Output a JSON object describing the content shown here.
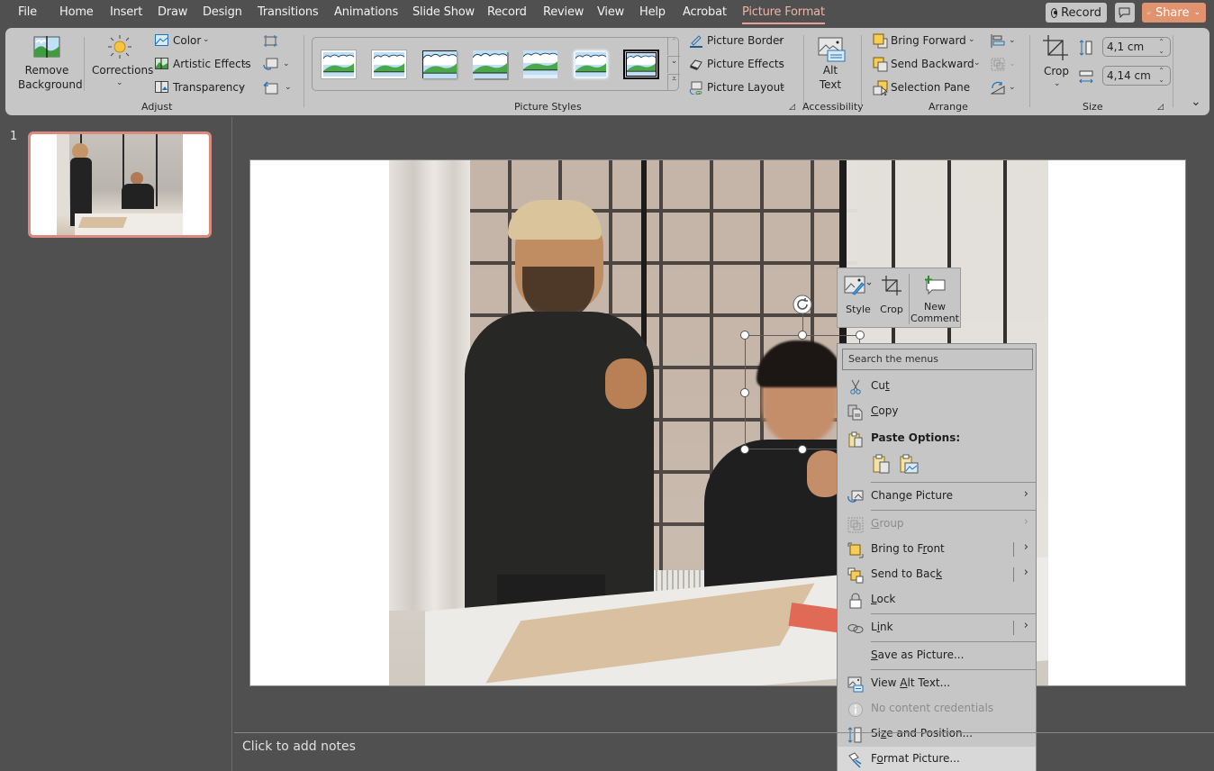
{
  "menubar": {
    "tabs": [
      "File",
      "Home",
      "Insert",
      "Draw",
      "Design",
      "Transitions",
      "Animations",
      "Slide Show",
      "Record",
      "Review",
      "View",
      "Help",
      "Acrobat",
      "Picture Format"
    ],
    "active_tab": "Picture Format",
    "record_label": "Record",
    "share_label": "Share",
    "accent_color": "#e1926e"
  },
  "ribbon": {
    "adjust": {
      "remove_background": [
        "Remove",
        "Background"
      ],
      "corrections": "Corrections",
      "color": "Color",
      "artistic_effects": "Artistic Effects",
      "transparency": "Transparency",
      "group_label": "Adjust"
    },
    "picture_styles": {
      "group_label": "Picture Styles",
      "style_count": 7,
      "picture_border": "Picture Border",
      "picture_effects": "Picture Effects",
      "picture_layout": "Picture Layout"
    },
    "accessibility": {
      "alt_text": [
        "Alt",
        "Text"
      ],
      "group_label": "Accessibility"
    },
    "arrange": {
      "bring_forward": "Bring Forward",
      "send_backward": "Send Backward",
      "selection_pane": "Selection Pane",
      "group_label": "Arrange"
    },
    "size": {
      "crop": "Crop",
      "height": "4,1 cm",
      "width": "4,14 cm",
      "group_label": "Size"
    }
  },
  "slides_panel": {
    "slide_number": "1"
  },
  "notes": {
    "placeholder": "Click to add notes"
  },
  "mini_toolbar": {
    "style": "Style",
    "crop": "Crop",
    "new_comment": [
      "New",
      "Comment"
    ]
  },
  "context_menu": {
    "search_placeholder": "Search the menus",
    "items": [
      {
        "label": "Cut",
        "icon": "scissors-icon"
      },
      {
        "label": "Copy",
        "icon": "copy-icon"
      },
      {
        "label": "Paste Options:",
        "icon": "paste-icon"
      },
      {
        "label": "Change Picture",
        "icon": "change-picture-icon",
        "submenu": true
      },
      {
        "label": "Group",
        "icon": "group-icon",
        "submenu": true,
        "disabled": true
      },
      {
        "label": "Bring to Front",
        "icon": "bring-to-front-icon",
        "submenu": true
      },
      {
        "label": "Send to Back",
        "icon": "send-to-back-icon",
        "submenu": true
      },
      {
        "label": "Lock",
        "icon": "lock-icon"
      },
      {
        "label": "Link",
        "icon": "link-icon",
        "submenu": true
      },
      {
        "label": "Save as Picture...",
        "icon": ""
      },
      {
        "label": "View Alt Text...",
        "icon": "alt-text-icon"
      },
      {
        "label": "No content credentials",
        "icon": "info-icon",
        "disabled": true
      },
      {
        "label": "Size and Position...",
        "icon": "size-position-icon"
      },
      {
        "label": "Format Picture...",
        "icon": "format-picture-icon"
      }
    ]
  }
}
